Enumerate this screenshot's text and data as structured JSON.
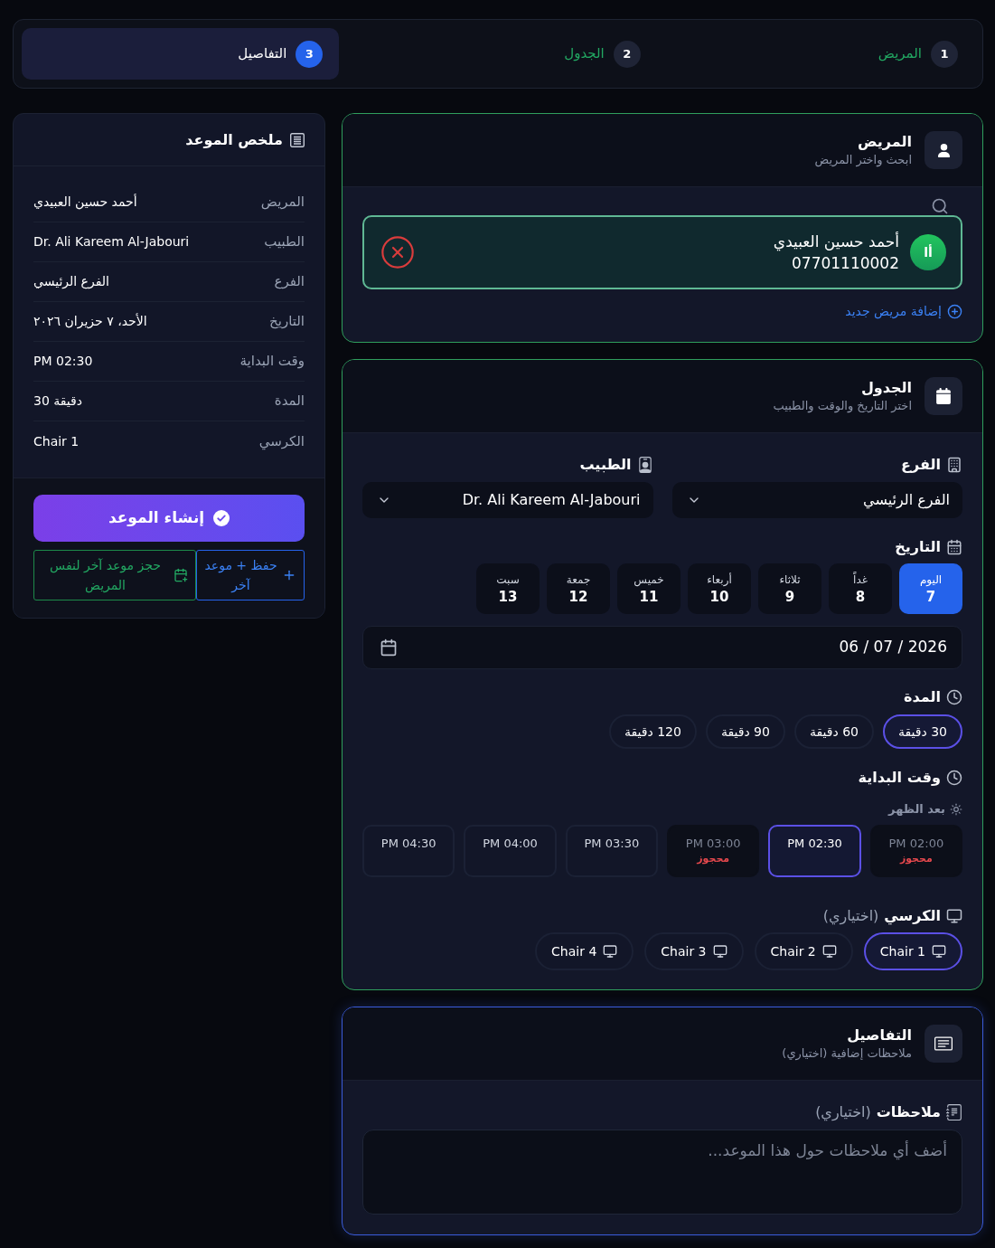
{
  "stepper": {
    "steps": [
      {
        "number": "1",
        "label": "المريض",
        "completed": true,
        "selected": false
      },
      {
        "number": "2",
        "label": "الجدول",
        "completed": true,
        "selected": false
      },
      {
        "number": "3",
        "label": "التفاصيل",
        "completed": false,
        "selected": true
      }
    ]
  },
  "patient_section": {
    "completed": true,
    "active": false,
    "title": "المريض",
    "subtitle": "ابحث واختر المريض",
    "selected_patient": {
      "initials": "أا",
      "name": "أحمد حسين العبيدي",
      "phone": "07701110002"
    },
    "add_link": "إضافة مريض جديد"
  },
  "schedule_section": {
    "completed": true,
    "active": false,
    "title": "الجدول",
    "subtitle": "اختر التاريخ والوقت والطبيب",
    "branch": {
      "label": "الفرع",
      "value": "الفرع الرئيسي"
    },
    "doctor": {
      "label": "الطبيب",
      "value": "Dr. Ali Kareem Al-Jabouri"
    },
    "date": {
      "label": "التاريخ",
      "days": [
        {
          "name": "اليوم",
          "day": "7",
          "selected": true
        },
        {
          "name": "غداً",
          "day": "8",
          "selected": false
        },
        {
          "name": "ثلاثاء",
          "day": "9",
          "selected": false
        },
        {
          "name": "أربعاء",
          "day": "10",
          "selected": false
        },
        {
          "name": "خميس",
          "day": "11",
          "selected": false
        },
        {
          "name": "جمعة",
          "day": "12",
          "selected": false
        },
        {
          "name": "سبت",
          "day": "13",
          "selected": false
        }
      ],
      "value": "06 / 07 / 2026"
    },
    "duration": {
      "label": "المدة",
      "options": [
        {
          "label": "30 دقيقة",
          "selected": true
        },
        {
          "label": "60 دقيقة",
          "selected": false
        },
        {
          "label": "90 دقيقة",
          "selected": false
        },
        {
          "label": "120 دقيقة",
          "selected": false
        }
      ]
    },
    "start_time": {
      "label": "وقت البداية",
      "period": "بعد الظهر",
      "slots": [
        {
          "time": "PM 02:00",
          "booked": true,
          "note": "محجوز",
          "selected": false
        },
        {
          "time": "PM 02:30",
          "booked": false,
          "selected": true
        },
        {
          "time": "PM 03:00",
          "booked": true,
          "note": "محجوز",
          "selected": false
        },
        {
          "time": "PM 03:30",
          "booked": false,
          "selected": false
        },
        {
          "time": "PM 04:00",
          "booked": false,
          "selected": false
        },
        {
          "time": "PM 04:30",
          "booked": false,
          "selected": false
        }
      ]
    },
    "chair": {
      "label": "الكرسي",
      "hint": "(اختياري)",
      "options": [
        {
          "label": "Chair 1",
          "selected": true
        },
        {
          "label": "Chair 2",
          "selected": false
        },
        {
          "label": "Chair 3",
          "selected": false
        },
        {
          "label": "Chair 4",
          "selected": false
        }
      ]
    }
  },
  "details_section": {
    "completed": false,
    "active": true,
    "title": "التفاصيل",
    "subtitle": "ملاحظات إضافية (اختياري)",
    "notes": {
      "label": "ملاحظات",
      "hint": "(اختياري)",
      "placeholder": "أضف أي ملاحظات حول هذا الموعد..."
    }
  },
  "summary": {
    "title": "ملخص الموعد",
    "rows": [
      {
        "label": "المريض",
        "value": "أحمد حسين العبيدي"
      },
      {
        "label": "الطبيب",
        "value": "Dr. Ali Kareem Al-Jabouri"
      },
      {
        "label": "الفرع",
        "value": "الفرع الرئيسي"
      },
      {
        "label": "التاريخ",
        "value": "الأحد، ٧ حزيران ٢٠٢٦"
      },
      {
        "label": "وقت البداية",
        "value": "PM 02:30"
      },
      {
        "label": "المدة",
        "value": "30 دقيقة"
      },
      {
        "label": "الكرسي",
        "value": "Chair 1"
      }
    ],
    "create_button": "إنشاء الموعد",
    "secondary_actions": [
      {
        "kind": "save_another",
        "label": "حفظ + موعد آخر"
      },
      {
        "kind": "book_same_patient",
        "label": "حجز موعد آخر لنفس المريض"
      }
    ]
  }
}
